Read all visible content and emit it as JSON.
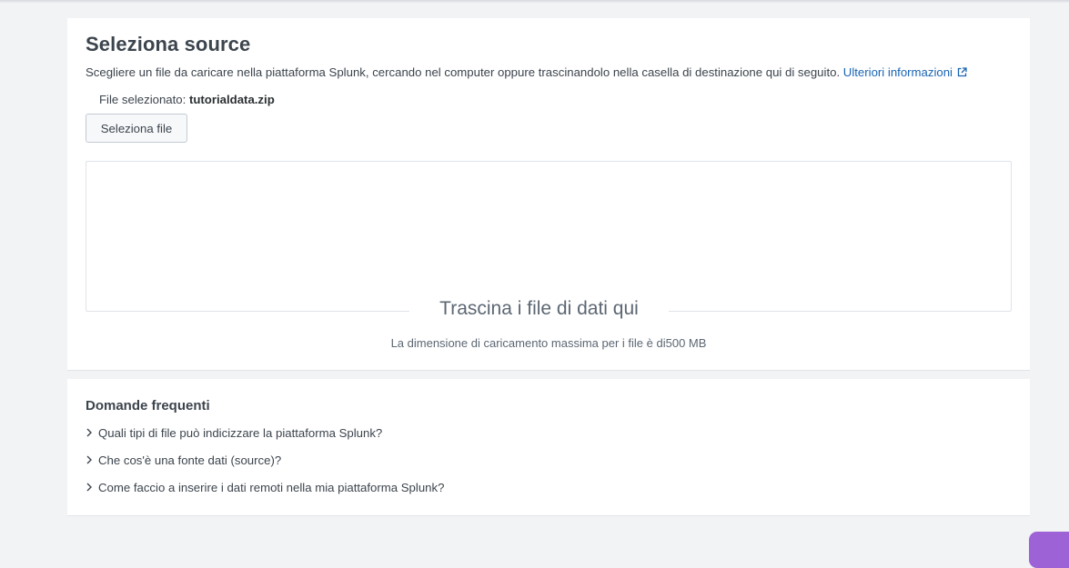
{
  "source_panel": {
    "title": "Seleziona source",
    "description": "Scegliere un file da caricare nella piattaforma Splunk, cercando nel computer oppure trascinandolo nella casella di destinazione qui di seguito.",
    "more_info_link": "Ulteriori informazioni",
    "selected_label": "File selezionato:",
    "selected_file": "tutorialdata.zip",
    "select_button": "Seleziona file",
    "drop_label": "Trascina i file di dati qui",
    "max_size_text": "La dimensione di caricamento massima per i file è di500 MB"
  },
  "faq": {
    "title": "Domande frequenti",
    "items": [
      {
        "label": "Quali tipi di file può indicizzare la piattaforma Splunk?"
      },
      {
        "label": "Che cos'è una fonte dati (source)?"
      },
      {
        "label": "Come faccio a inserire i dati remoti nella mia piattaforma Splunk?"
      }
    ]
  },
  "icons": {
    "external_link": "external-link-icon",
    "chevron": "chevron-right-icon"
  },
  "colors": {
    "link": "#1a64b4",
    "corner_button": "#9c62d6",
    "background": "#f2f3f5"
  }
}
